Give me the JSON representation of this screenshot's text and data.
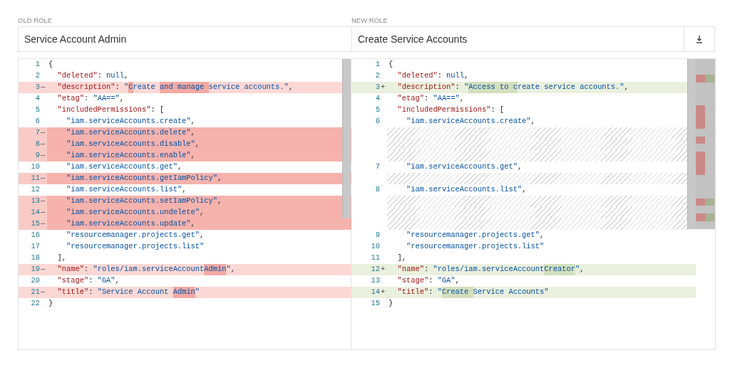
{
  "panes": [
    {
      "kind": "old",
      "label": "OLD ROLE",
      "title": "Service Account Admin",
      "lines": [
        {
          "kind": "same",
          "number": "1",
          "tokens": [
            {
              "text": "{",
              "kind": "punct"
            }
          ]
        },
        {
          "kind": "same",
          "number": "2",
          "tokens": [
            {
              "text": "  \"deleted\"",
              "kind": "key"
            },
            {
              "text": ": ",
              "kind": "punct"
            },
            {
              "text": "null",
              "kind": "literal"
            },
            {
              "text": ",",
              "kind": "punct"
            }
          ]
        },
        {
          "kind": "modified",
          "number": "3",
          "marker": "—",
          "tokens": [
            {
              "text": "  \"description\"",
              "kind": "key",
              "changed": false
            },
            {
              "text": ": ",
              "kind": "punct",
              "changed": false
            },
            {
              "text": "\"",
              "kind": "string",
              "changed": false
            },
            {
              "text": "C",
              "kind": "string",
              "changed": true
            },
            {
              "text": "reate ",
              "kind": "string",
              "changed": false
            },
            {
              "text": "and manage ",
              "kind": "string",
              "changed": true
            },
            {
              "text": "service accounts.\"",
              "kind": "string",
              "changed": false
            },
            {
              "text": ",",
              "kind": "punct",
              "changed": false
            }
          ]
        },
        {
          "kind": "same",
          "number": "4",
          "tokens": [
            {
              "text": "  \"etag\"",
              "kind": "key"
            },
            {
              "text": ": ",
              "kind": "punct"
            },
            {
              "text": "\"AA==\"",
              "kind": "string"
            },
            {
              "text": ",",
              "kind": "punct"
            }
          ]
        },
        {
          "kind": "same",
          "number": "5",
          "tokens": [
            {
              "text": "  \"includedPermissions\"",
              "kind": "key"
            },
            {
              "text": ": [",
              "kind": "punct"
            }
          ]
        },
        {
          "kind": "same",
          "number": "6",
          "tokens": [
            {
              "text": "    \"iam.serviceAccounts.create\"",
              "kind": "string"
            },
            {
              "text": ",",
              "kind": "punct"
            }
          ]
        },
        {
          "kind": "removed",
          "number": "7",
          "marker": "—",
          "tokens": [
            {
              "text": "    \"iam.serviceAccounts.delete\"",
              "kind": "string"
            },
            {
              "text": ",",
              "kind": "punct"
            }
          ]
        },
        {
          "kind": "removed",
          "number": "8",
          "marker": "—",
          "tokens": [
            {
              "text": "    \"iam.serviceAccounts.disable\"",
              "kind": "string"
            },
            {
              "text": ",",
              "kind": "punct"
            }
          ]
        },
        {
          "kind": "removed",
          "number": "9",
          "marker": "—",
          "tokens": [
            {
              "text": "    \"iam.serviceAccounts.enable\"",
              "kind": "string"
            },
            {
              "text": ",",
              "kind": "punct"
            }
          ]
        },
        {
          "kind": "same",
          "number": "10",
          "tokens": [
            {
              "text": "    \"iam.serviceAccounts.get\"",
              "kind": "string"
            },
            {
              "text": ",",
              "kind": "punct"
            }
          ]
        },
        {
          "kind": "removed",
          "number": "11",
          "marker": "—",
          "tokens": [
            {
              "text": "    \"iam.serviceAccounts.getIamPolicy\"",
              "kind": "string"
            },
            {
              "text": ",",
              "kind": "punct"
            }
          ]
        },
        {
          "kind": "same",
          "number": "12",
          "tokens": [
            {
              "text": "    \"iam.serviceAccounts.list\"",
              "kind": "string"
            },
            {
              "text": ",",
              "kind": "punct"
            }
          ]
        },
        {
          "kind": "removed",
          "number": "13",
          "marker": "—",
          "tokens": [
            {
              "text": "    \"iam.serviceAccounts.setIamPolicy\"",
              "kind": "string"
            },
            {
              "text": ",",
              "kind": "punct"
            }
          ]
        },
        {
          "kind": "removed",
          "number": "14",
          "marker": "—",
          "tokens": [
            {
              "text": "    \"iam.serviceAccounts.undelete\"",
              "kind": "string"
            },
            {
              "text": ",",
              "kind": "punct"
            }
          ]
        },
        {
          "kind": "removed",
          "number": "15",
          "marker": "—",
          "tokens": [
            {
              "text": "    \"iam.serviceAccounts.update\"",
              "kind": "string"
            },
            {
              "text": ",",
              "kind": "punct"
            }
          ]
        },
        {
          "kind": "same",
          "number": "16",
          "tokens": [
            {
              "text": "    \"resourcemanager.projects.get\"",
              "kind": "string"
            },
            {
              "text": ",",
              "kind": "punct"
            }
          ]
        },
        {
          "kind": "same",
          "number": "17",
          "tokens": [
            {
              "text": "    \"resourcemanager.projects.list\"",
              "kind": "string"
            }
          ]
        },
        {
          "kind": "same",
          "number": "18",
          "tokens": [
            {
              "text": "  ],",
              "kind": "punct"
            }
          ]
        },
        {
          "kind": "modified",
          "number": "19",
          "marker": "—",
          "tokens": [
            {
              "text": "  \"name\"",
              "kind": "key",
              "changed": false
            },
            {
              "text": ": ",
              "kind": "punct",
              "changed": false
            },
            {
              "text": "\"roles/iam.serviceAccount",
              "kind": "string",
              "changed": false
            },
            {
              "text": "Admin",
              "kind": "string",
              "changed": true
            },
            {
              "text": "\"",
              "kind": "string",
              "changed": false
            },
            {
              "text": ",",
              "kind": "punct",
              "changed": false
            }
          ]
        },
        {
          "kind": "same",
          "number": "20",
          "tokens": [
            {
              "text": "  \"stage\"",
              "kind": "key"
            },
            {
              "text": ": ",
              "kind": "punct"
            },
            {
              "text": "\"GA\"",
              "kind": "string"
            },
            {
              "text": ",",
              "kind": "punct"
            }
          ]
        },
        {
          "kind": "modified",
          "number": "21",
          "marker": "—",
          "tokens": [
            {
              "text": "  \"title\"",
              "kind": "key",
              "changed": false
            },
            {
              "text": ": ",
              "kind": "punct",
              "changed": false
            },
            {
              "text": "\"Service Account",
              "kind": "string",
              "changed": false
            },
            {
              "text": " Admin",
              "kind": "string",
              "changed": true
            },
            {
              "text": "\"",
              "kind": "string",
              "changed": false
            }
          ]
        },
        {
          "kind": "same",
          "number": "22",
          "tokens": [
            {
              "text": "}",
              "kind": "punct"
            }
          ]
        }
      ]
    },
    {
      "kind": "new",
      "label": "NEW ROLE",
      "title": "Create Service Accounts",
      "lines": [
        {
          "kind": "same",
          "number": "1",
          "tokens": [
            {
              "text": "{",
              "kind": "punct"
            }
          ]
        },
        {
          "kind": "same",
          "number": "2",
          "tokens": [
            {
              "text": "  \"deleted\"",
              "kind": "key"
            },
            {
              "text": ": ",
              "kind": "punct"
            },
            {
              "text": "null",
              "kind": "literal"
            },
            {
              "text": ",",
              "kind": "punct"
            }
          ]
        },
        {
          "kind": "modified",
          "number": "3",
          "marker": "+",
          "tokens": [
            {
              "text": "  \"description\"",
              "kind": "key",
              "changed": false
            },
            {
              "text": ": ",
              "kind": "punct",
              "changed": false
            },
            {
              "text": "\"",
              "kind": "string",
              "changed": false
            },
            {
              "text": "Access to c",
              "kind": "string",
              "changed": true
            },
            {
              "text": "reate service accounts.\"",
              "kind": "string",
              "changed": false
            },
            {
              "text": ",",
              "kind": "punct",
              "changed": false
            }
          ]
        },
        {
          "kind": "same",
          "number": "4",
          "tokens": [
            {
              "text": "  \"etag\"",
              "kind": "key"
            },
            {
              "text": ": ",
              "kind": "punct"
            },
            {
              "text": "\"AA==\"",
              "kind": "string"
            },
            {
              "text": ",",
              "kind": "punct"
            }
          ]
        },
        {
          "kind": "same",
          "number": "5",
          "tokens": [
            {
              "text": "  \"includedPermissions\"",
              "kind": "key"
            },
            {
              "text": ": [",
              "kind": "punct"
            }
          ]
        },
        {
          "kind": "same",
          "number": "6",
          "tokens": [
            {
              "text": "    \"iam.serviceAccounts.create\"",
              "kind": "string"
            },
            {
              "text": ",",
              "kind": "punct"
            }
          ]
        },
        {
          "kind": "filler"
        },
        {
          "kind": "filler"
        },
        {
          "kind": "filler"
        },
        {
          "kind": "same",
          "number": "7",
          "tokens": [
            {
              "text": "    \"iam.serviceAccounts.get\"",
              "kind": "string"
            },
            {
              "text": ",",
              "kind": "punct"
            }
          ]
        },
        {
          "kind": "filler"
        },
        {
          "kind": "same",
          "number": "8",
          "tokens": [
            {
              "text": "    \"iam.serviceAccounts.list\"",
              "kind": "string"
            },
            {
              "text": ",",
              "kind": "punct"
            }
          ]
        },
        {
          "kind": "filler"
        },
        {
          "kind": "filler"
        },
        {
          "kind": "filler"
        },
        {
          "kind": "same",
          "number": "9",
          "tokens": [
            {
              "text": "    \"resourcemanager.projects.get\"",
              "kind": "string"
            },
            {
              "text": ",",
              "kind": "punct"
            }
          ]
        },
        {
          "kind": "same",
          "number": "10",
          "tokens": [
            {
              "text": "    \"resourcemanager.projects.list\"",
              "kind": "string"
            }
          ]
        },
        {
          "kind": "same",
          "number": "11",
          "tokens": [
            {
              "text": "  ],",
              "kind": "punct"
            }
          ]
        },
        {
          "kind": "modified",
          "number": "12",
          "marker": "+",
          "tokens": [
            {
              "text": "  \"name\"",
              "kind": "key",
              "changed": false
            },
            {
              "text": ": ",
              "kind": "punct",
              "changed": false
            },
            {
              "text": "\"roles/iam.serviceAccount",
              "kind": "string",
              "changed": false
            },
            {
              "text": "Creator",
              "kind": "string",
              "changed": true
            },
            {
              "text": "\"",
              "kind": "string",
              "changed": false
            },
            {
              "text": ",",
              "kind": "punct",
              "changed": false
            }
          ]
        },
        {
          "kind": "same",
          "number": "13",
          "tokens": [
            {
              "text": "  \"stage\"",
              "kind": "key"
            },
            {
              "text": ": ",
              "kind": "punct"
            },
            {
              "text": "\"GA\"",
              "kind": "string"
            },
            {
              "text": ",",
              "kind": "punct"
            }
          ]
        },
        {
          "kind": "modified",
          "number": "14",
          "marker": "+",
          "tokens": [
            {
              "text": "  \"title\"",
              "kind": "key",
              "changed": false
            },
            {
              "text": ": ",
              "kind": "punct",
              "changed": false
            },
            {
              "text": "\"",
              "kind": "string",
              "changed": false
            },
            {
              "text": "Create ",
              "kind": "string",
              "changed": true
            },
            {
              "text": "Service Accounts",
              "kind": "string",
              "changed": false
            },
            {
              "text": "\"",
              "kind": "string",
              "changed": false
            }
          ]
        },
        {
          "kind": "same",
          "number": "15",
          "tokens": [
            {
              "text": "}",
              "kind": "punct"
            }
          ]
        }
      ]
    }
  ]
}
